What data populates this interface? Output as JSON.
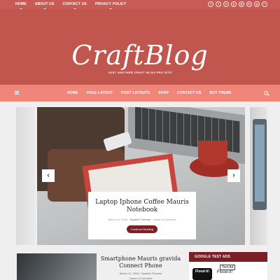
{
  "topbar": {
    "links": [
      "HOME",
      "ABOUT US",
      "CONTACT US",
      "PRIVACY POLICY"
    ],
    "social_icons": [
      "facebook-icon",
      "twitter-icon",
      "youtube-icon",
      "pinterest-icon",
      "instagram-icon",
      "linkedin-icon",
      "google-plus-icon",
      "rss-icon"
    ]
  },
  "header": {
    "logo": "CraftBlog",
    "tagline": "JUST ANOTHER CRAFT BLOG PRO SITE"
  },
  "nav": {
    "links": [
      "HOME",
      "PAGE LAYOUT",
      "POST LAYOUTS",
      "SHOP",
      "CONTACT US",
      "BUY THEME"
    ]
  },
  "slider": {
    "prev": "‹",
    "next": "›",
    "title": "Laptop Iphone Coffee Mauris Notebook",
    "date": "March 11, 2016",
    "separator": "·",
    "author": "Sparkle Themes",
    "comments": "Leave a Comment",
    "button": "Continue Reading"
  },
  "post": {
    "title": "Smartphone Mauris gravida Connect Phone",
    "date": "March 11, 2016",
    "author_prefix": "• Sparkle Themes",
    "comments": "Leave a Comment"
  },
  "widget": {
    "title": "GOOGLE TEST ADS",
    "ad_icon_text": "Flood-It!",
    "ad_label": "Test Ad",
    "ad_name": "Flood-It!"
  },
  "colors": {
    "topbar": "#c95b57",
    "header": "#c1564f",
    "nav": "#f08579",
    "accent": "#7a1f26"
  }
}
